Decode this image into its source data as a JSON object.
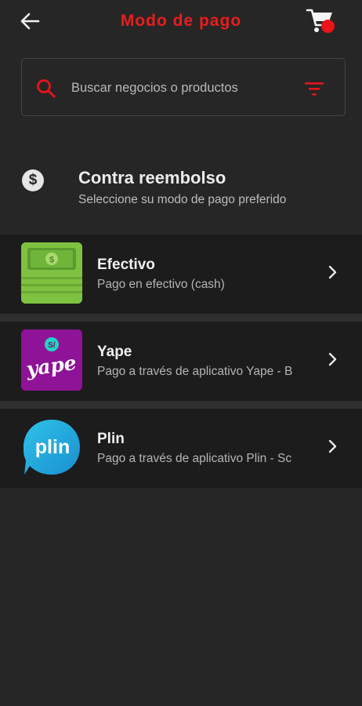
{
  "header": {
    "title": "Modo de pago",
    "back_icon": "arrow-left-icon",
    "cart_icon": "shopping-cart-icon"
  },
  "search": {
    "placeholder": "Buscar negocios o productos",
    "value": "",
    "filter_icon": "filter-icon"
  },
  "section": {
    "icon": "dollar-icon",
    "icon_glyph": "$",
    "title": "Contra reembolso",
    "subtitle": "Seleccione su modo de pago preferido"
  },
  "payment_options": [
    {
      "name": "Efectivo",
      "description": "Pago en efectivo (cash)",
      "logo": "cash-bill-logo"
    },
    {
      "name": "Yape",
      "description": "Pago a través de aplicativo Yape - B",
      "logo": "yape-logo",
      "logo_text": "yape"
    },
    {
      "name": "Plin",
      "description": "Pago a través de aplicativo Plin - Sc",
      "logo": "plin-logo",
      "logo_text": "plin"
    }
  ],
  "colors": {
    "accent": "#ea1d1d",
    "background": "#262626",
    "card": "#1c1c1c",
    "yape": "#8e1397",
    "plin": "#1aa7d8",
    "efectivo": "#7fc241"
  }
}
